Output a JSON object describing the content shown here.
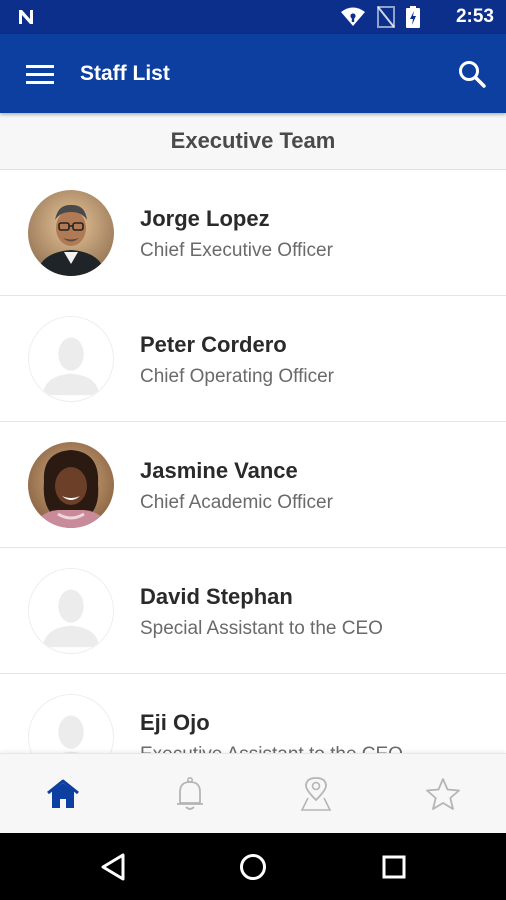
{
  "status_bar": {
    "time": "2:53",
    "icons": [
      "n-logo-icon",
      "wifi-icon",
      "no-sim-icon",
      "battery-icon"
    ]
  },
  "app_bar": {
    "title": "Staff List",
    "left_icon": "menu-icon",
    "right_icon": "search-icon"
  },
  "section": {
    "title": "Executive Team"
  },
  "staff": [
    {
      "name": "Jorge Lopez",
      "role": "Chief Executive Officer",
      "avatar": "photo"
    },
    {
      "name": "Peter Cordero",
      "role": "Chief Operating Officer",
      "avatar": "placeholder"
    },
    {
      "name": "Jasmine Vance",
      "role": "Chief Academic Officer",
      "avatar": "photo"
    },
    {
      "name": "David Stephan",
      "role": "Special Assistant to the CEO",
      "avatar": "placeholder"
    },
    {
      "name": "Eji Ojo",
      "role": "Executive Assistant to the CEO",
      "avatar": "placeholder"
    }
  ],
  "bottom_nav": {
    "items": [
      "home-icon",
      "bell-icon",
      "map-pin-icon",
      "star-icon"
    ],
    "active": "home-icon"
  },
  "system_nav": [
    "back-icon",
    "home-circle-icon",
    "recents-icon"
  ],
  "colors": {
    "status_bar": "#0b2f8a",
    "app_bar": "#0d3fa0",
    "accent": "#0d3fa0",
    "inactive_icon": "#b5b5b5"
  }
}
